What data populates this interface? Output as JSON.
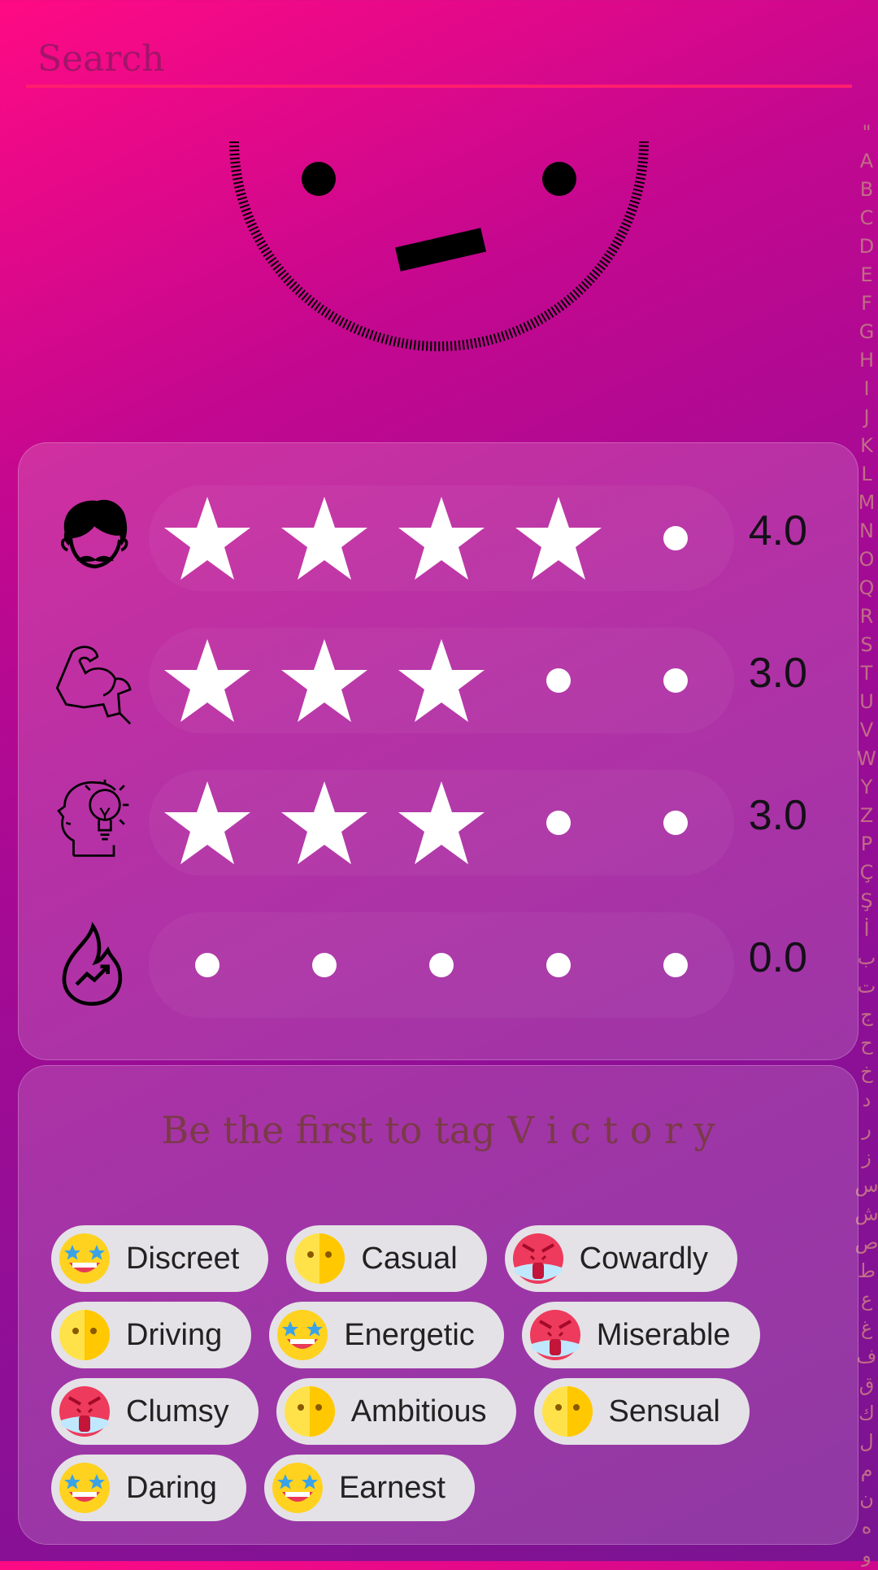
{
  "search": {
    "placeholder": "Search",
    "value": ""
  },
  "mood_face": {
    "expression": "neutral-flat-mouth",
    "stroke": "#000000"
  },
  "ratings": [
    {
      "icon": "man-face-mustache-icon",
      "value": 4,
      "label": "4.0"
    },
    {
      "icon": "strong-arm-icon",
      "value": 3,
      "label": "3.0"
    },
    {
      "icon": "head-lightbulb-icon",
      "value": 3,
      "label": "3.0"
    },
    {
      "icon": "flame-trend-icon",
      "value": 0,
      "label": "0.0"
    }
  ],
  "rating_max": 5,
  "tag_prompt": "Be the first to tag V i c t o r y",
  "tag_rows": [
    [
      {
        "label": "Discreet",
        "emoji": "star-struck-icon"
      },
      {
        "label": "Casual",
        "emoji": "neutral-face-icon"
      },
      {
        "label": "Cowardly",
        "emoji": "angry-face-icon"
      }
    ],
    [
      {
        "label": "Driving",
        "emoji": "neutral-face-icon"
      },
      {
        "label": "Energetic",
        "emoji": "star-struck-icon"
      },
      {
        "label": "Miserable",
        "emoji": "angry-face-icon"
      }
    ],
    [
      {
        "label": "Clumsy",
        "emoji": "angry-face-icon"
      },
      {
        "label": "Ambitious",
        "emoji": "neutral-face-icon"
      },
      {
        "label": "Sensual",
        "emoji": "neutral-face-icon"
      }
    ],
    [
      {
        "label": "Daring",
        "emoji": "star-struck-icon"
      },
      {
        "label": "Earnest",
        "emoji": "star-struck-icon"
      }
    ]
  ],
  "index_letters": [
    "\"",
    "A",
    "B",
    "C",
    "D",
    "E",
    "F",
    "G",
    "H",
    "I",
    "J",
    "K",
    "L",
    "M",
    "N",
    "O",
    "Q",
    "R",
    "S",
    "T",
    "U",
    "V",
    "W",
    "Y",
    "Z",
    "P",
    "Ç",
    "Ş",
    "İ",
    "ب",
    "ت",
    "ج",
    "ح",
    "خ",
    "د",
    "ر",
    "ز",
    "س",
    "ش",
    "ص",
    "ط",
    "ع",
    "غ",
    "ف",
    "ق",
    "ك",
    "ل",
    "م",
    "ن",
    "ه",
    "و"
  ],
  "colors": {
    "search_underline": "#ff1e6e",
    "gradient_start": "#ff0a84",
    "gradient_end": "#7a1492",
    "index_letter": "#c06d86"
  }
}
